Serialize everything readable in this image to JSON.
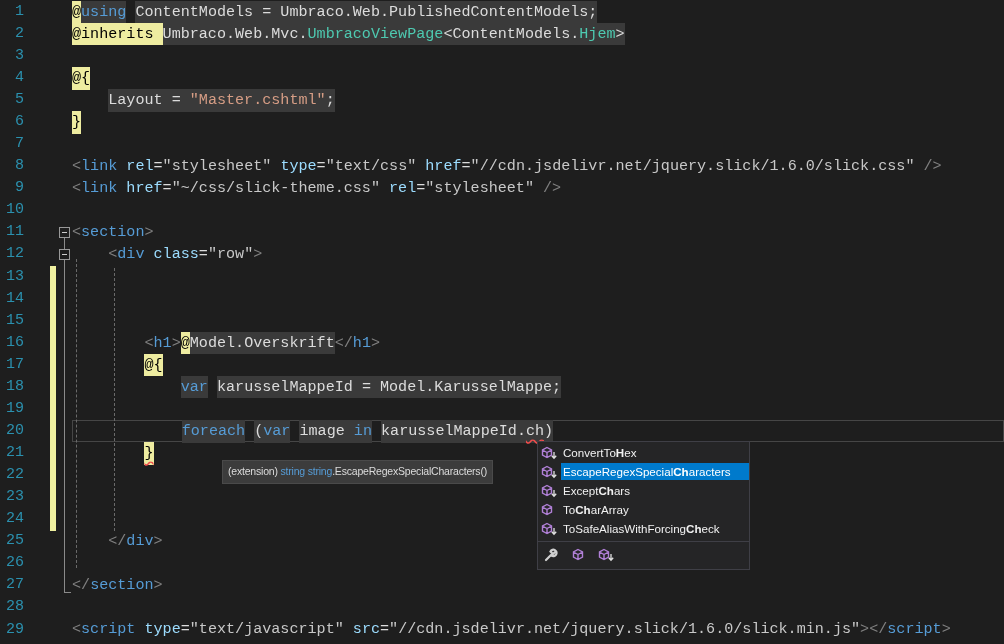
{
  "lines": [
    {
      "number": "1",
      "tokens": [
        {
          "t": "@",
          "kind": "rz"
        },
        {
          "t": "using",
          "kind": "kw",
          "shaded": true
        },
        {
          "t": " ContentModels = Umbraco.Web.PublishedContentModels;",
          "kind": "p",
          "shaded": true
        }
      ]
    },
    {
      "number": "2",
      "tokens": [
        {
          "t": "@inherits ",
          "kind": "rz"
        },
        {
          "t": "Umbraco.Web.Mvc.",
          "kind": "p",
          "shaded": true
        },
        {
          "t": "UmbracoViewPage",
          "kind": "ty",
          "shaded": true
        },
        {
          "t": "<ContentModels.",
          "kind": "p",
          "shaded": true
        },
        {
          "t": "Hjem",
          "kind": "ty",
          "shaded": true
        },
        {
          "t": ">",
          "kind": "p",
          "shaded": true
        }
      ]
    },
    {
      "number": "3"
    },
    {
      "number": "4",
      "tokens": [
        {
          "t": "@{",
          "kind": "rz"
        }
      ]
    },
    {
      "number": "5",
      "tokens": [
        {
          "t": "    Layout = ",
          "kind": "p",
          "shaded": true
        },
        {
          "t": "\"Master.cshtml\"",
          "kind": "str",
          "shaded": true
        },
        {
          "t": ";",
          "kind": "p",
          "shaded": true
        }
      ]
    },
    {
      "number": "6",
      "tokens": [
        {
          "t": "}",
          "kind": "rz"
        }
      ]
    },
    {
      "number": "7"
    },
    {
      "number": "8",
      "tokens": [
        {
          "t": "<",
          "kind": "br"
        },
        {
          "t": "link",
          "kind": "tag"
        },
        {
          "t": " rel",
          "kind": "attr"
        },
        {
          "t": "=",
          "kind": "p"
        },
        {
          "t": "\"stylesheet\"",
          "kind": "q"
        },
        {
          "t": " type",
          "kind": "attr"
        },
        {
          "t": "=",
          "kind": "p"
        },
        {
          "t": "\"text/css\"",
          "kind": "q"
        },
        {
          "t": " href",
          "kind": "attr"
        },
        {
          "t": "=",
          "kind": "p"
        },
        {
          "t": "\"//cdn.jsdelivr.net/jquery.slick/1.6.0/slick.css\"",
          "kind": "q"
        },
        {
          "t": " />",
          "kind": "br"
        }
      ]
    },
    {
      "number": "9",
      "tokens": [
        {
          "t": "<",
          "kind": "br"
        },
        {
          "t": "link",
          "kind": "tag"
        },
        {
          "t": " href",
          "kind": "attr"
        },
        {
          "t": "=",
          "kind": "p"
        },
        {
          "t": "\"~/css/slick-theme.css\"",
          "kind": "q"
        },
        {
          "t": " rel",
          "kind": "attr"
        },
        {
          "t": "=",
          "kind": "p"
        },
        {
          "t": "\"stylesheet\"",
          "kind": "q"
        },
        {
          "t": " />",
          "kind": "br"
        }
      ]
    },
    {
      "number": "10"
    },
    {
      "number": "11",
      "expanded": true,
      "tokens": [
        {
          "t": "<",
          "kind": "br"
        },
        {
          "t": "section",
          "kind": "tag"
        },
        {
          "t": ">",
          "kind": "br"
        }
      ]
    },
    {
      "number": "12",
      "expanded": true,
      "tokens": [
        {
          "t": "    <",
          "kind": "br"
        },
        {
          "t": "div",
          "kind": "tag"
        },
        {
          "t": " class",
          "kind": "attr"
        },
        {
          "t": "=",
          "kind": "p"
        },
        {
          "t": "\"row\"",
          "kind": "q"
        },
        {
          "t": ">",
          "kind": "br"
        }
      ]
    },
    {
      "number": "13",
      "changed": true
    },
    {
      "number": "14",
      "changed": true
    },
    {
      "number": "15",
      "changed": true
    },
    {
      "number": "16",
      "changed": true,
      "tokens": [
        {
          "t": "        <",
          "kind": "br"
        },
        {
          "t": "h1",
          "kind": "tag"
        },
        {
          "t": ">",
          "kind": "br"
        },
        {
          "t": "@",
          "kind": "rz"
        },
        {
          "t": "Model.Overskrift",
          "kind": "p",
          "shaded": true
        },
        {
          "t": "</",
          "kind": "br"
        },
        {
          "t": "h1",
          "kind": "tag"
        },
        {
          "t": ">",
          "kind": "br"
        }
      ]
    },
    {
      "number": "17",
      "changed": true,
      "tokens": [
        {
          "t": "        @{",
          "kind": "rz"
        }
      ]
    },
    {
      "number": "18",
      "changed": true,
      "tokens": [
        {
          "t": "            var",
          "kind": "kw",
          "shaded": true
        },
        {
          "t": " karusselMappeId = Model.KarusselMappe;",
          "kind": "p",
          "shaded": true
        }
      ]
    },
    {
      "number": "19",
      "changed": true
    },
    {
      "number": "20",
      "changed": true,
      "current": true,
      "tokens": [
        {
          "t": "            foreach",
          "kind": "kw",
          "shaded": true
        },
        {
          "t": " (",
          "kind": "p",
          "shaded": true
        },
        {
          "t": "var",
          "kind": "kw",
          "shaded": true
        },
        {
          "t": " image ",
          "kind": "p",
          "shaded": true
        },
        {
          "t": "in",
          "kind": "kw",
          "shaded": true
        },
        {
          "t": " karusselMappeId.",
          "kind": "p",
          "shaded": true
        },
        {
          "t": "ch",
          "kind": "p",
          "shaded": true,
          "error": true
        },
        {
          "t": ")",
          "kind": "p",
          "shaded": true
        }
      ]
    },
    {
      "number": "21",
      "changed": true,
      "tokens": [
        {
          "t": "        }",
          "kind": "rz",
          "error": true
        }
      ]
    },
    {
      "number": "22",
      "changed": true
    },
    {
      "number": "23",
      "changed": true
    },
    {
      "number": "24",
      "changed": true
    },
    {
      "number": "25",
      "tokens": [
        {
          "t": "    </",
          "kind": "br"
        },
        {
          "t": "div",
          "kind": "tag"
        },
        {
          "t": ">",
          "kind": "br"
        }
      ]
    },
    {
      "number": "26"
    },
    {
      "number": "27",
      "tokens": [
        {
          "t": "</",
          "kind": "br"
        },
        {
          "t": "section",
          "kind": "tag"
        },
        {
          "t": ">",
          "kind": "br"
        }
      ]
    },
    {
      "number": "28"
    },
    {
      "number": "29",
      "tokens": [
        {
          "t": "<",
          "kind": "br"
        },
        {
          "t": "script",
          "kind": "tag"
        },
        {
          "t": " type",
          "kind": "attr"
        },
        {
          "t": "=",
          "kind": "p"
        },
        {
          "t": "\"text/javascript\"",
          "kind": "q"
        },
        {
          "t": " src",
          "kind": "attr"
        },
        {
          "t": "=",
          "kind": "p"
        },
        {
          "t": "\"//cdn.jsdelivr.net/jquery.slick/1.6.0/slick.min.js\"",
          "kind": "q"
        },
        {
          "t": "></",
          "kind": "br"
        },
        {
          "t": "script",
          "kind": "tag"
        },
        {
          "t": ">",
          "kind": "br"
        }
      ]
    }
  ],
  "tooltip": [
    {
      "t": "(extension) ",
      "kind": "p"
    },
    {
      "t": "string string",
      "kind": "kw"
    },
    {
      "t": ".EscapeRegexSpecialCharacters()",
      "kind": "p"
    }
  ],
  "completion": {
    "items": [
      {
        "label": "ConvertTo**H**ex",
        "kind": "extension",
        "selected": false
      },
      {
        "label": "EscapeRegexSpecial**Ch**aracters",
        "kind": "extension",
        "selected": true
      },
      {
        "label": "Except**Ch**ars",
        "kind": "extension",
        "selected": false
      },
      {
        "label": "To**Ch**arArray",
        "kind": "method",
        "selected": false
      },
      {
        "label": "ToSafeAliasWithForcing**Ch**eck",
        "kind": "extension",
        "selected": false
      }
    ],
    "filters": [
      {
        "kind": "wrench"
      },
      {
        "kind": "method"
      },
      {
        "kind": "extension"
      }
    ]
  }
}
